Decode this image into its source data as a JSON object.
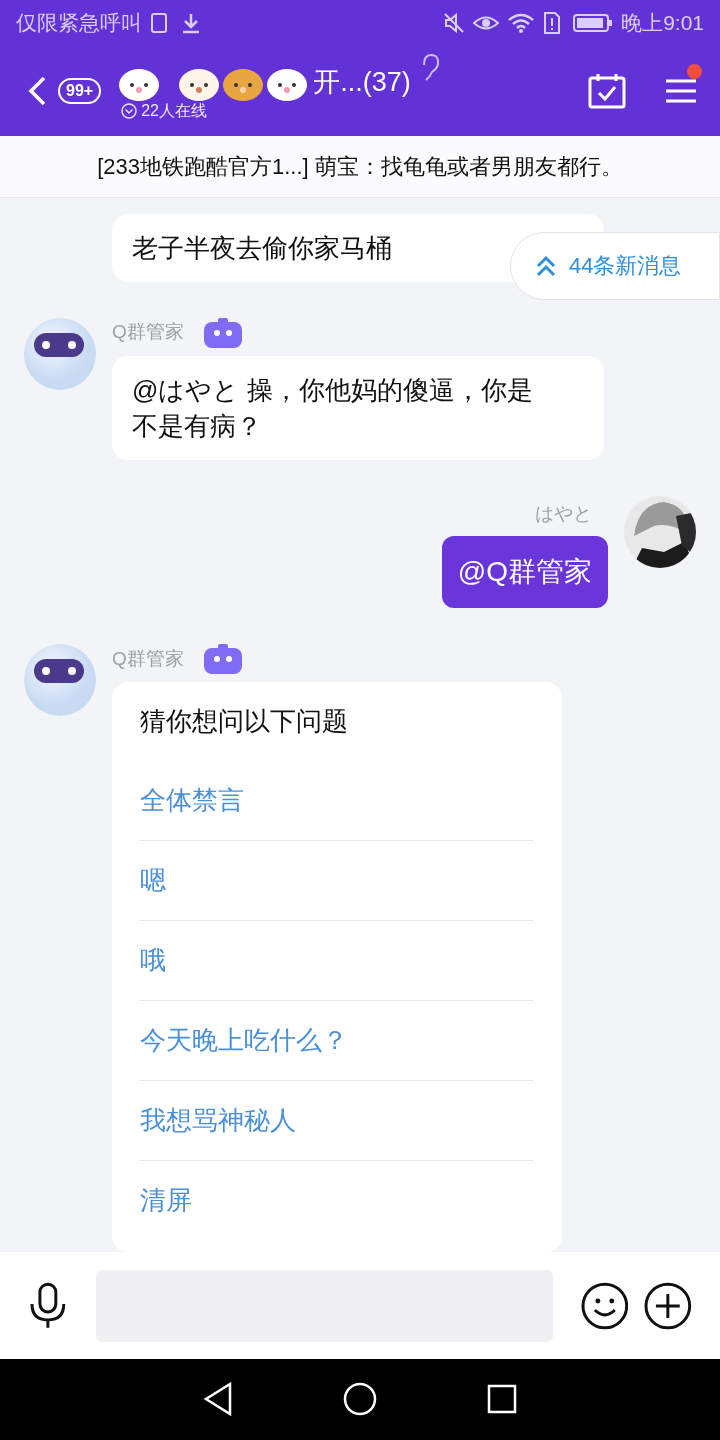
{
  "status_bar": {
    "carrier": "仅限紧急呼叫",
    "time": "晚上9:01"
  },
  "header": {
    "unread_badge": "99+",
    "title": "开...(37)",
    "online": "22人在线",
    "menu_notification": true
  },
  "pinned_banner": "[233地铁跑酷官方1...] 萌宝：找龟龟或者男朋友都行。",
  "new_messages": "44条新消息",
  "messages": [
    {
      "kind": "incoming",
      "text": "老子半夜去偷你家马桶"
    },
    {
      "kind": "incoming",
      "sender": "Q群管家",
      "bot": true,
      "text": "@はやと 操，你他妈的傻逼，你是不是有病？"
    },
    {
      "kind": "outgoing",
      "sender": "はやと",
      "text": "@Q群管家"
    },
    {
      "kind": "suggestions",
      "sender": "Q群管家",
      "bot": true,
      "title": "猜你想问以下问题",
      "items": [
        "全体禁言",
        "嗯",
        "哦",
        "今天晚上吃什么？",
        "我想骂神秘人",
        "清屏"
      ]
    }
  ]
}
